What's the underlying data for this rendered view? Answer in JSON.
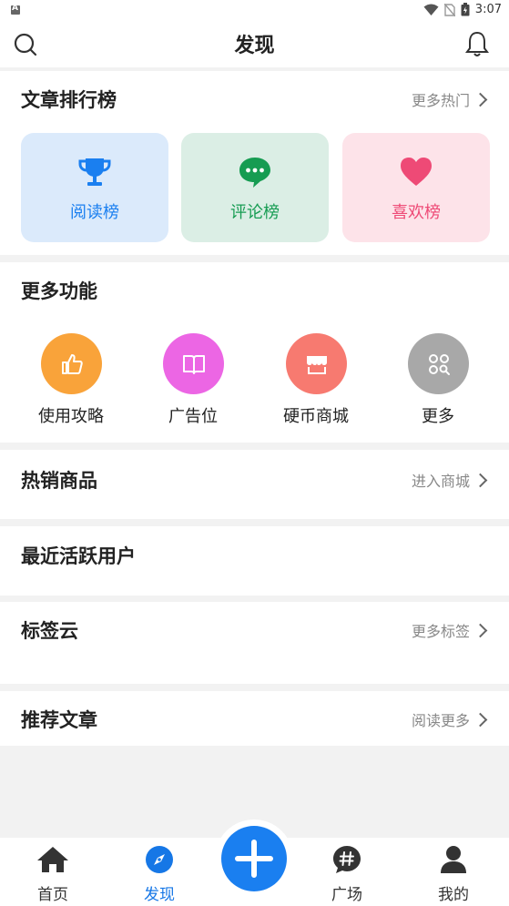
{
  "status": {
    "time": "3:07"
  },
  "header": {
    "title": "发现"
  },
  "ranking": {
    "title": "文章排行榜",
    "more": "更多热门",
    "tiles": [
      {
        "label": "阅读榜",
        "icon": "trophy-icon",
        "bg": "#dbeafb",
        "color": "#1a7ff0"
      },
      {
        "label": "评论榜",
        "icon": "comment-icon",
        "bg": "#dbeee5",
        "color": "#169c52"
      },
      {
        "label": "喜欢榜",
        "icon": "heart-icon",
        "bg": "#fde3e9",
        "color": "#ee4a76"
      }
    ]
  },
  "functions": {
    "title": "更多功能",
    "items": [
      {
        "label": "使用攻略",
        "icon": "thumbs-up-icon",
        "color": "#f9a33a"
      },
      {
        "label": "广告位",
        "icon": "book-icon",
        "color": "#ec66e4"
      },
      {
        "label": "硬币商城",
        "icon": "shop-icon",
        "color": "#f77a70"
      },
      {
        "label": "更多",
        "icon": "apps-search-icon",
        "color": "#a8a8a8"
      }
    ]
  },
  "hot_goods": {
    "title": "热销商品",
    "more": "进入商城"
  },
  "active_users": {
    "title": "最近活跃用户"
  },
  "tags": {
    "title": "标签云",
    "more": "更多标签"
  },
  "recommend": {
    "title": "推荐文章",
    "more": "阅读更多"
  },
  "tabbar": {
    "items": [
      {
        "label": "首页",
        "icon": "home-icon"
      },
      {
        "label": "发现",
        "icon": "compass-icon",
        "active": true
      },
      {
        "label": "",
        "icon": "plus-icon"
      },
      {
        "label": "广场",
        "icon": "hashtag-chat-icon"
      },
      {
        "label": "我的",
        "icon": "user-icon"
      }
    ]
  }
}
